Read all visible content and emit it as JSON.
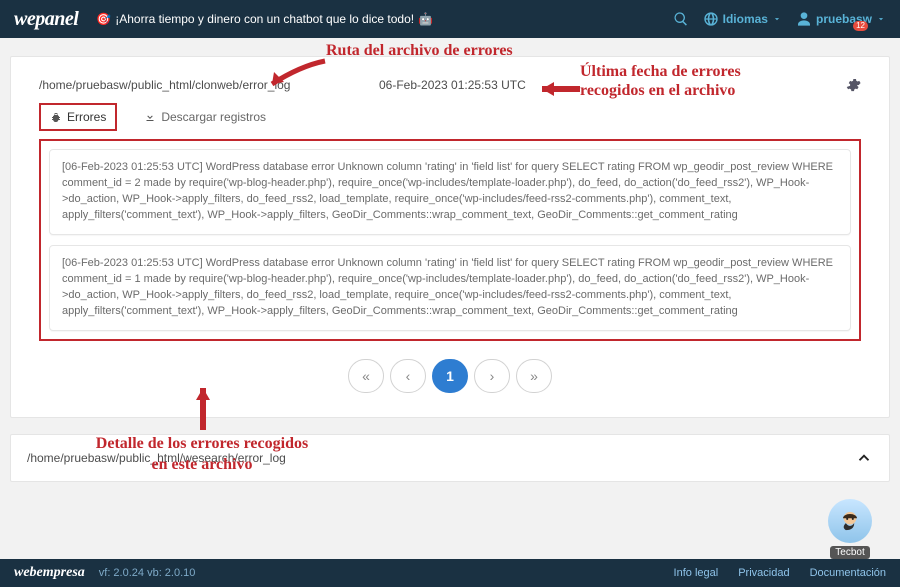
{
  "topbar": {
    "brand": "wepanel",
    "slogan_prefix": "🎯 ",
    "slogan": "¡Ahorra tiempo y dinero con un chatbot que lo dice todo!",
    "slogan_suffix": " 🤖",
    "language_label": "Idiomas",
    "user": "pruebasw",
    "notif_count": "12"
  },
  "card": {
    "path": "/home/pruebasw/public_html/clonweb/error_log",
    "date": "06-Feb-2023 01:25:53 UTC",
    "tabs": {
      "errors": "Errores",
      "download": "Descargar registros"
    },
    "errors": [
      "[06-Feb-2023 01:25:53 UTC] WordPress database error Unknown column 'rating' in 'field list' for query SELECT rating FROM wp_geodir_post_review WHERE comment_id = 2 made by require('wp-blog-header.php'), require_once('wp-includes/template-loader.php'), do_feed, do_action('do_feed_rss2'), WP_Hook->do_action, WP_Hook->apply_filters, do_feed_rss2, load_template, require_once('wp-includes/feed-rss2-comments.php'), comment_text, apply_filters('comment_text'), WP_Hook->apply_filters, GeoDir_Comments::wrap_comment_text, GeoDir_Comments::get_comment_rating",
      "[06-Feb-2023 01:25:53 UTC] WordPress database error Unknown column 'rating' in 'field list' for query SELECT rating FROM wp_geodir_post_review WHERE comment_id = 1 made by require('wp-blog-header.php'), require_once('wp-includes/template-loader.php'), do_feed, do_action('do_feed_rss2'), WP_Hook->do_action, WP_Hook->apply_filters, do_feed_rss2, load_template, require_once('wp-includes/feed-rss2-comments.php'), comment_text, apply_filters('comment_text'), WP_Hook->apply_filters, GeoDir_Comments::wrap_comment_text, GeoDir_Comments::get_comment_rating"
    ],
    "pager": {
      "first": "«",
      "prev": "‹",
      "current": "1",
      "next": "›",
      "last": "»"
    }
  },
  "card2": {
    "path": "/home/pruebasw/public_html/wesearch/error_log"
  },
  "annotations": {
    "top_left": "Ruta del archivo de errores",
    "top_right_l1": "Última fecha de errores",
    "top_right_l2": "recogidos en el archivo",
    "bottom_l1": "Detalle de los errores recogidos",
    "bottom_l2": "en este archivo"
  },
  "bot": {
    "name": "Tecbot"
  },
  "footer": {
    "brand": "webempresa",
    "version": "vf: 2.0.24 vb: 2.0.10",
    "links": {
      "legal": "Info legal",
      "privacy": "Privacidad",
      "docs": "Documentación"
    }
  }
}
